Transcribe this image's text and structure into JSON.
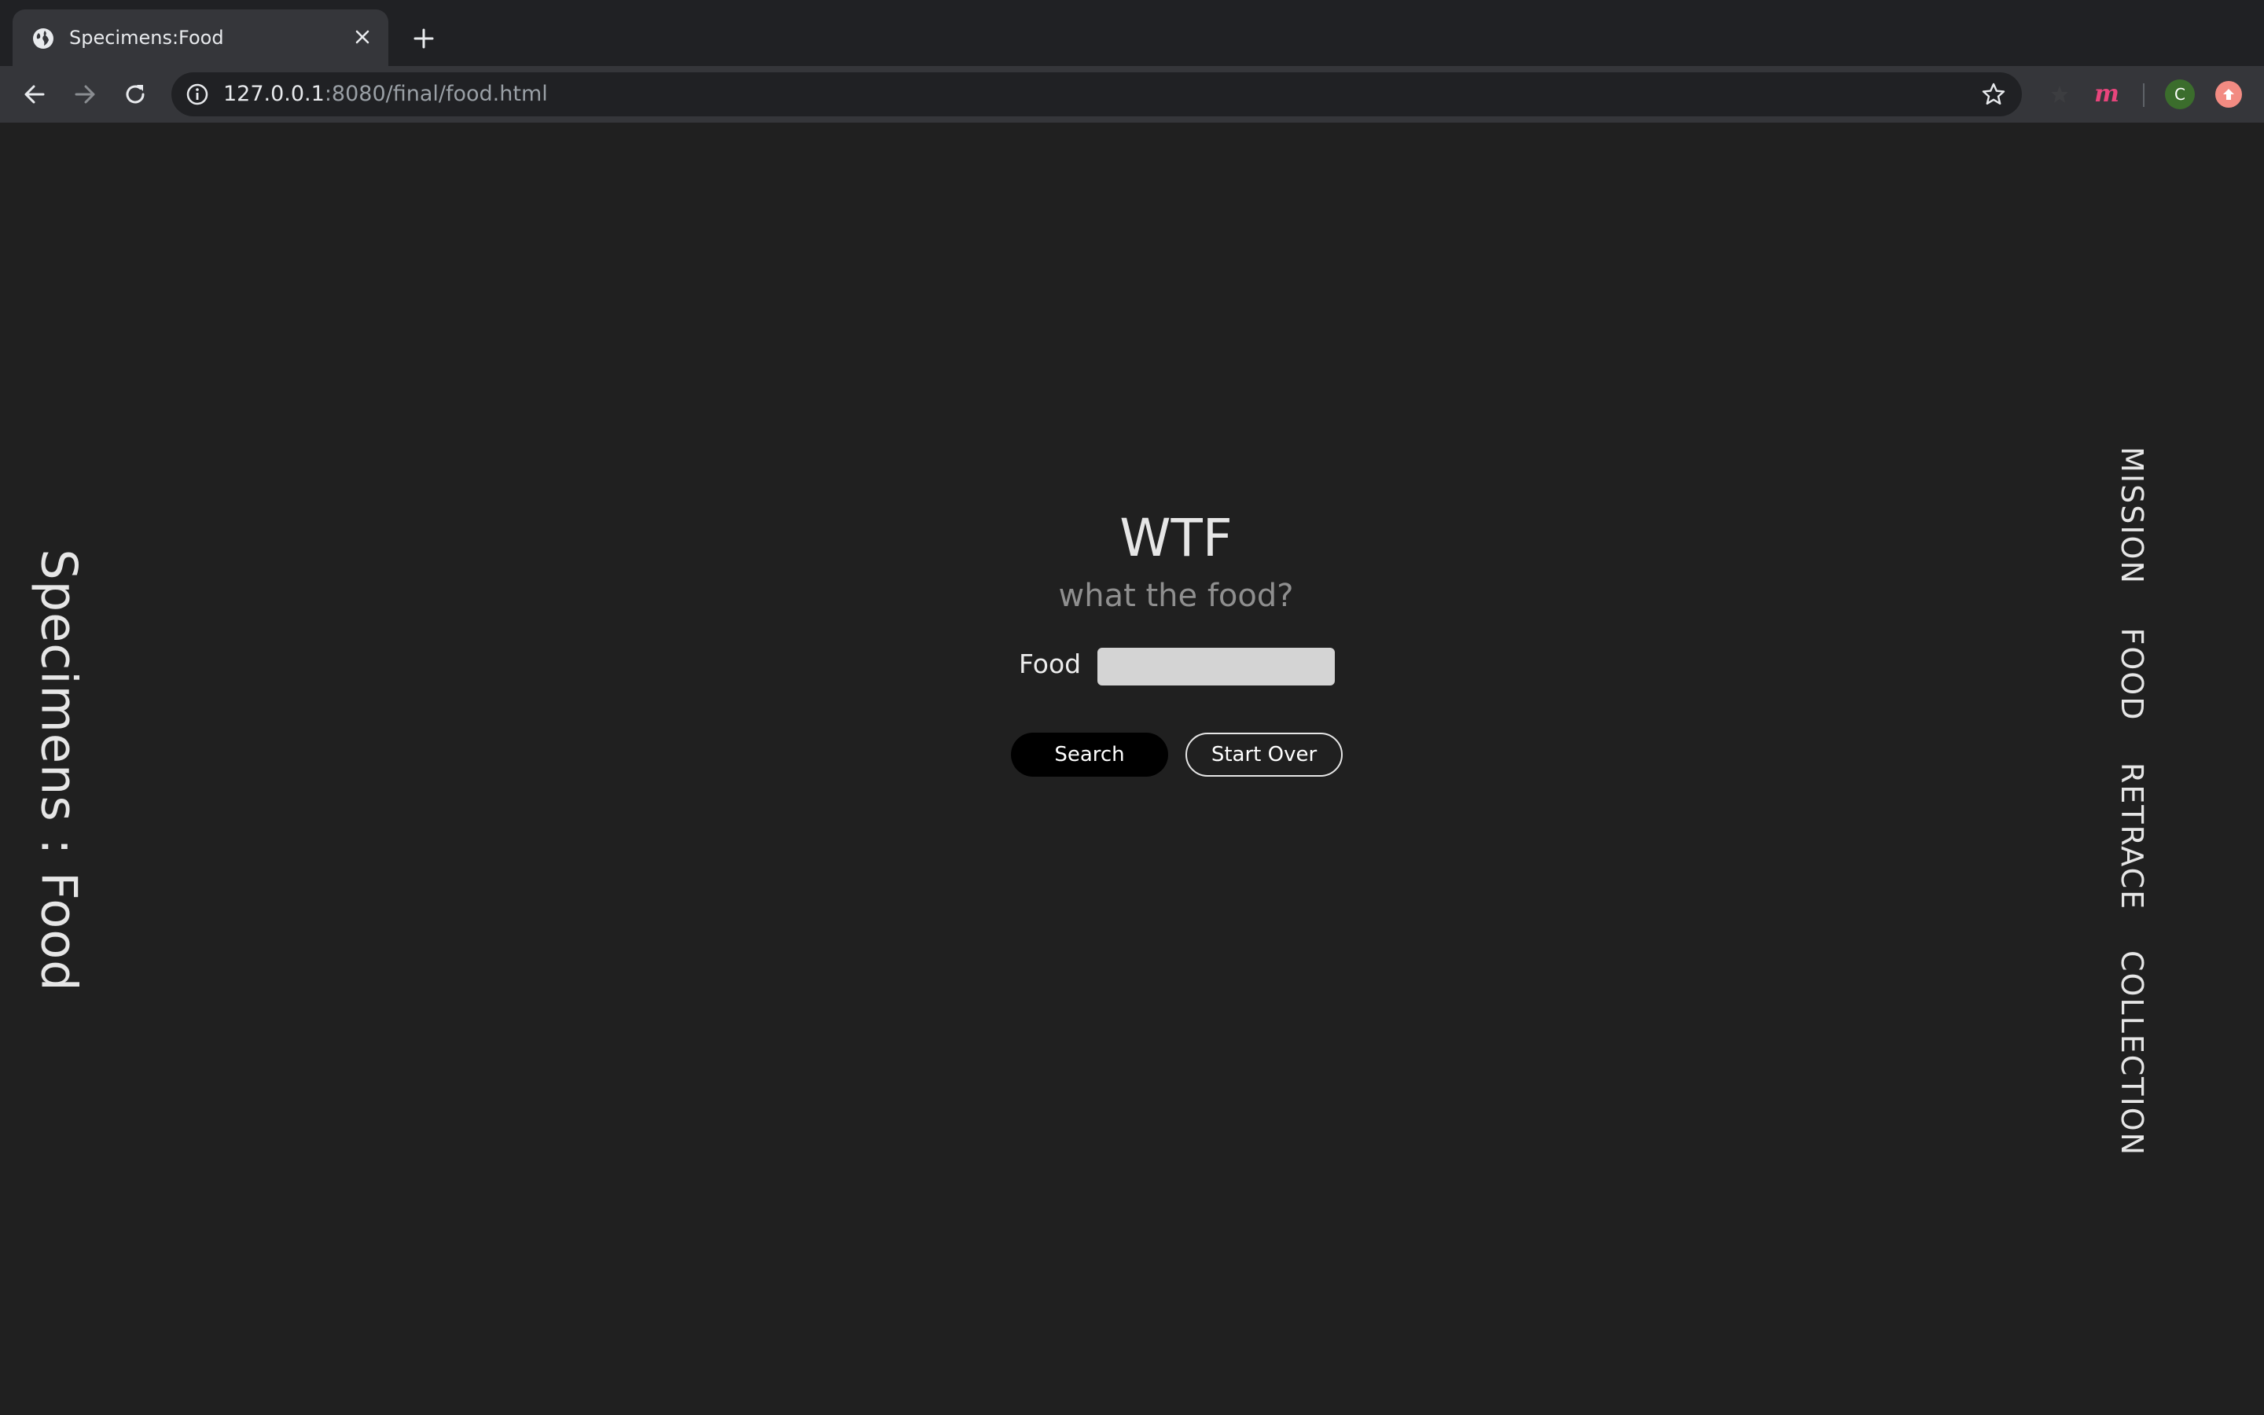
{
  "browser": {
    "tab": {
      "title": "Specimens:Food",
      "favicon": "globe-icon"
    },
    "url": {
      "host": "127.0.0.1",
      "rest": ":8080/final/food.html"
    },
    "profile_initial": "C",
    "icons": {
      "back": "arrow-left-icon",
      "forward": "arrow-right-icon",
      "reload": "reload-icon",
      "info": "info-icon",
      "bookmark": "star-icon",
      "extension_m": "m-extension-icon",
      "update": "update-icon"
    }
  },
  "page": {
    "side_title": "Specimens : Food",
    "title": "WTF",
    "subtitle": "what the food?",
    "form": {
      "food_label": "Food",
      "food_value": "",
      "search_label": "Search",
      "start_over_label": "Start Over"
    },
    "nav": {
      "items": [
        {
          "label": "MISSION"
        },
        {
          "label": "FOOD"
        },
        {
          "label": "RETRACE"
        },
        {
          "label": "COLLECTION"
        }
      ]
    }
  },
  "colors": {
    "background": "#202020",
    "text": "#e6e6e6",
    "subtitle": "#8f8f8f",
    "input_background": "#d4d4d4",
    "search_button": "#000000",
    "extension_m": "#e8457c"
  }
}
